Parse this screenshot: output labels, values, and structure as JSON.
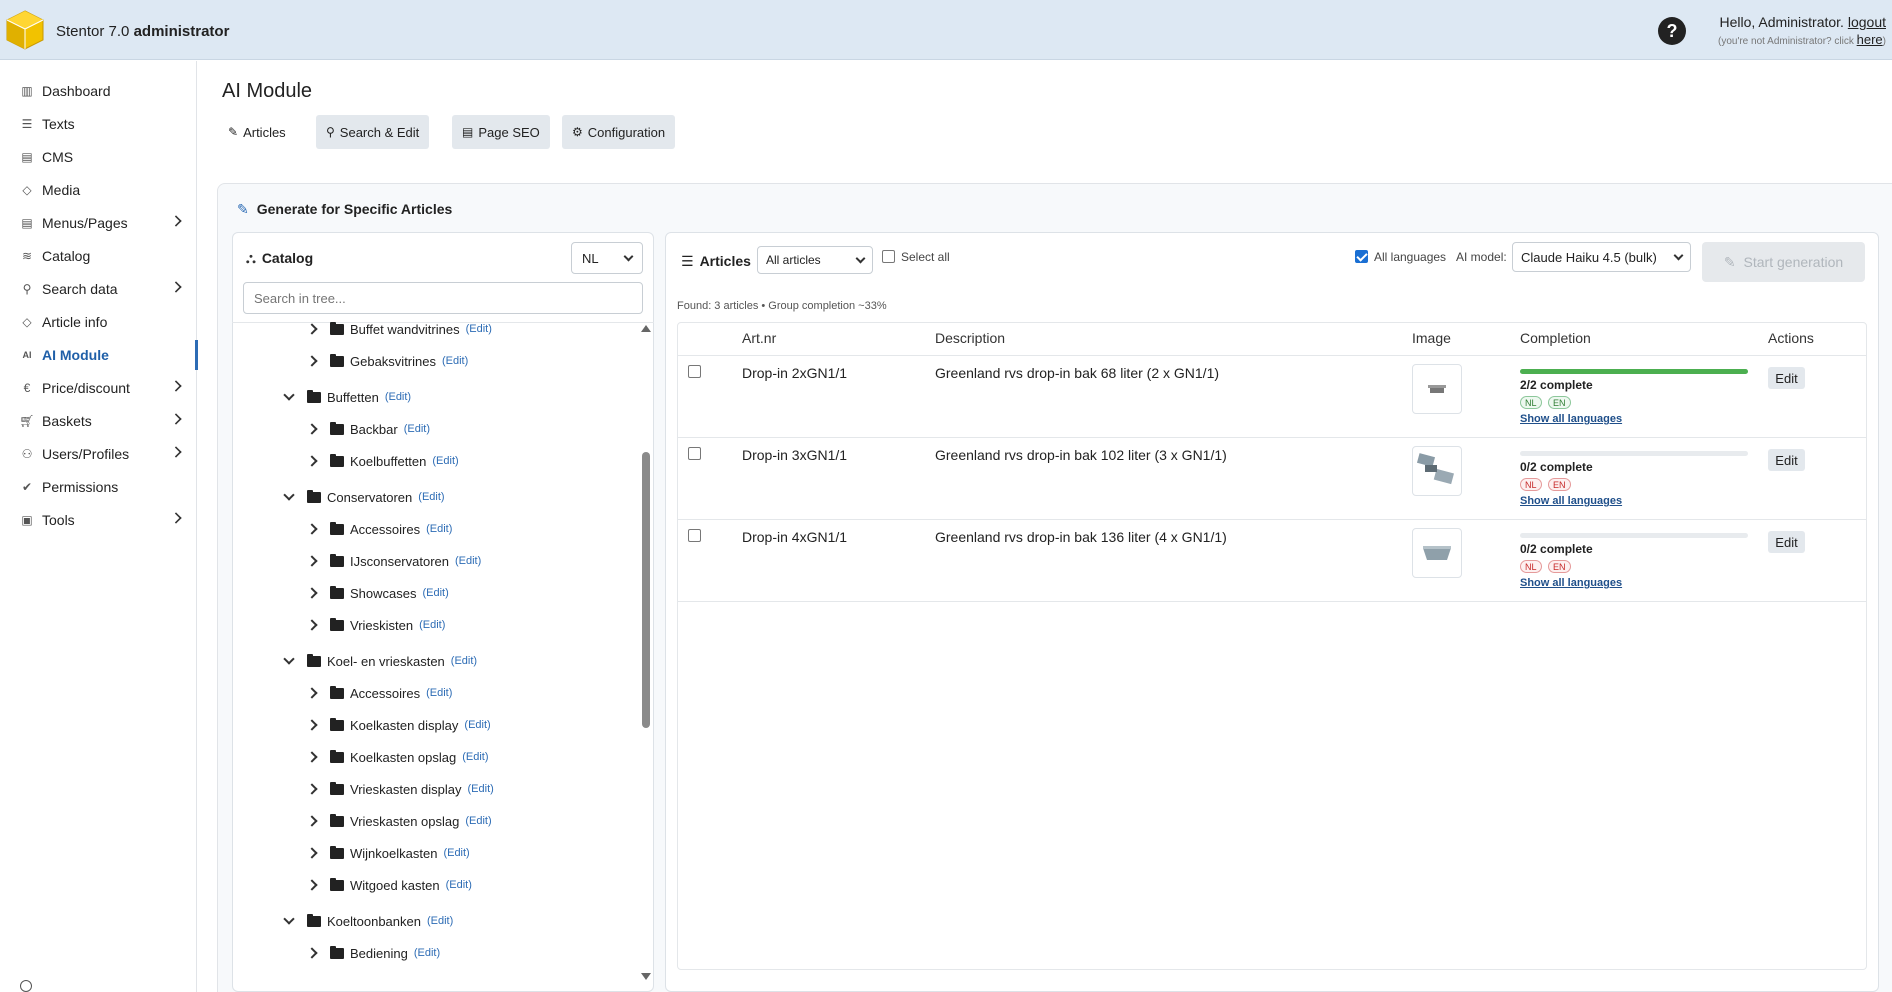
{
  "header": {
    "product": "Stentor 7.0",
    "role": "administrator",
    "greeting": "Hello, Administrator.",
    "logout": "logout",
    "not_user": "(you're not Administrator? click",
    "here": "here",
    "not_user_end": ")",
    "help": "?"
  },
  "sidebar": {
    "items": [
      {
        "label": "Dashboard",
        "icon": "bar-chart-icon"
      },
      {
        "label": "Texts",
        "icon": "text-lines-icon"
      },
      {
        "label": "CMS",
        "icon": "layout-icon"
      },
      {
        "label": "Media",
        "icon": "tag-icon"
      },
      {
        "label": "Menus/Pages",
        "icon": "layout-icon"
      },
      {
        "label": "Catalog",
        "icon": "database-icon"
      },
      {
        "label": "Search data",
        "icon": "search-icon"
      },
      {
        "label": "Article info",
        "icon": "tag-icon"
      },
      {
        "label": "AI Module",
        "icon": "ai-icon"
      },
      {
        "label": "Price/discount",
        "icon": "euro-icon"
      },
      {
        "label": "Baskets",
        "icon": "cart-icon"
      },
      {
        "label": "Users/Profiles",
        "icon": "users-icon"
      },
      {
        "label": "Permissions",
        "icon": "check-icon"
      },
      {
        "label": "Tools",
        "icon": "tools-icon"
      }
    ]
  },
  "page": {
    "title": "AI Module",
    "tabs": [
      {
        "label": "Articles",
        "icon": "pencil-icon"
      },
      {
        "label": "Search & Edit",
        "icon": "search-icon"
      },
      {
        "label": "Page SEO",
        "icon": "document-icon"
      },
      {
        "label": "Configuration",
        "icon": "gear-icon"
      }
    ]
  },
  "generate": {
    "title": "Generate for Specific Articles"
  },
  "catalog": {
    "title": "Catalog",
    "language": "NL",
    "search_placeholder": "Search in tree...",
    "edit_label": "(Edit)",
    "tree": [
      {
        "label": "Buffet wandvitrines",
        "level": 1,
        "open": false
      },
      {
        "label": "Gebaksvitrines",
        "level": 1,
        "open": false
      },
      {
        "label": "Buffetten",
        "level": 0,
        "open": true
      },
      {
        "label": "Backbar",
        "level": 1,
        "open": false
      },
      {
        "label": "Koelbuffetten",
        "level": 1,
        "open": false
      },
      {
        "label": "Conservatoren",
        "level": 0,
        "open": true
      },
      {
        "label": "Accessoires",
        "level": 1,
        "open": false
      },
      {
        "label": "IJsconservatoren",
        "level": 1,
        "open": false
      },
      {
        "label": "Showcases",
        "level": 1,
        "open": false
      },
      {
        "label": "Vrieskisten",
        "level": 1,
        "open": false
      },
      {
        "label": "Koel- en vrieskasten",
        "level": 0,
        "open": true
      },
      {
        "label": "Accessoires",
        "level": 1,
        "open": false
      },
      {
        "label": "Koelkasten display",
        "level": 1,
        "open": false
      },
      {
        "label": "Koelkasten opslag",
        "level": 1,
        "open": false
      },
      {
        "label": "Vrieskasten display",
        "level": 1,
        "open": false
      },
      {
        "label": "Vrieskasten opslag",
        "level": 1,
        "open": false
      },
      {
        "label": "Wijnkoelkasten",
        "level": 1,
        "open": false
      },
      {
        "label": "Witgoed kasten",
        "level": 1,
        "open": false
      },
      {
        "label": "Koeltoonbanken",
        "level": 0,
        "open": true
      },
      {
        "label": "Bediening",
        "level": 1,
        "open": false
      }
    ]
  },
  "articles": {
    "title": "Articles",
    "filter": "All articles",
    "select_all": "Select all",
    "all_languages": "All languages",
    "ai_model_label": "AI model:",
    "ai_model": "Claude Haiku 4.5 (bulk)",
    "start_button": "Start generation",
    "found": "Found: 3 articles • Group completion ~33%",
    "columns": [
      "Art.nr",
      "Description",
      "Image",
      "Completion",
      "Actions"
    ],
    "show_all": "Show all languages",
    "edit": "Edit",
    "rows": [
      {
        "artnr": "Drop-in 2xGN1/1",
        "description": "Greenland rvs drop-in bak 68 liter (2 x GN1/1)",
        "completion": "2/2 complete",
        "progress": 1.0,
        "nl_done": true,
        "en_done": true
      },
      {
        "artnr": "Drop-in 3xGN1/1",
        "description": "Greenland rvs drop-in bak 102 liter (3 x GN1/1)",
        "completion": "0/2 complete",
        "progress": 0.0,
        "nl_done": false,
        "en_done": false
      },
      {
        "artnr": "Drop-in 4xGN1/1",
        "description": "Greenland rvs drop-in bak 136 liter (4 x GN1/1)",
        "completion": "0/2 complete",
        "progress": 0.0,
        "nl_done": false,
        "en_done": false
      }
    ],
    "lang_nl": "NL",
    "lang_en": "EN"
  }
}
